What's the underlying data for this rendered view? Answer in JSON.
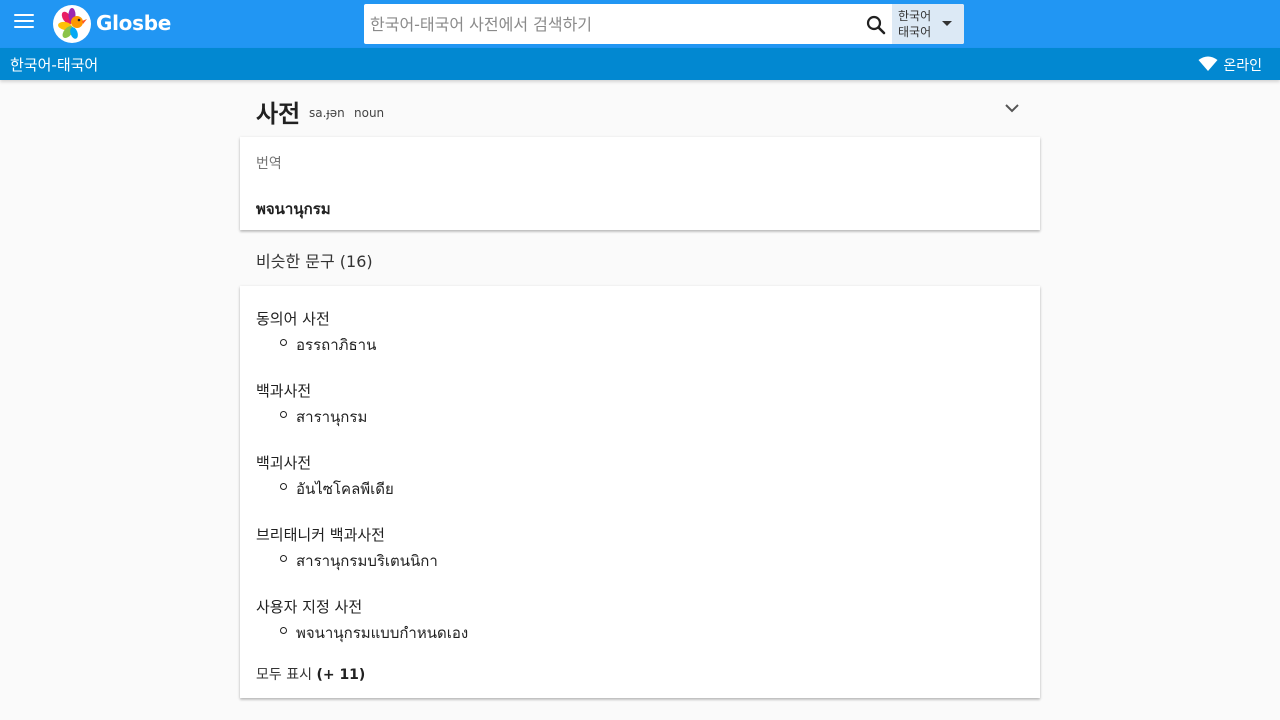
{
  "header": {
    "brand": "Glosbe",
    "search_placeholder": "한국어-태국어 사전에서 검색하기",
    "lang_from": "한국어",
    "lang_to": "태국어"
  },
  "subheader": {
    "pair": "한국어-태국어",
    "status": "온라인"
  },
  "entry": {
    "word": "사전",
    "ipa": "sa.ɟən",
    "pos": "noun",
    "translations_label": "번역",
    "translation": "พจนานุกรม"
  },
  "phrases": {
    "title": "비슷한 문구 (16)",
    "items": [
      {
        "src": "동의어 사전",
        "dst": "อรรถาภิธาน"
      },
      {
        "src": "백과사전",
        "dst": "สารานุกรม"
      },
      {
        "src": "백괴사전",
        "dst": "อันไซโคลพีเดีย"
      },
      {
        "src": "브리태니커 백과사전",
        "dst": "สารานุกรมบริเตนนิกา"
      },
      {
        "src": "사용자 지정 사전",
        "dst": "พจนานุกรมแบบกำหนดเอง"
      }
    ],
    "show_all": "모두 표시",
    "show_all_count": "(+ 11)"
  },
  "colors": {
    "primary": "#2196f3",
    "primary_dark": "#0288d1",
    "background": "#fafafa"
  }
}
